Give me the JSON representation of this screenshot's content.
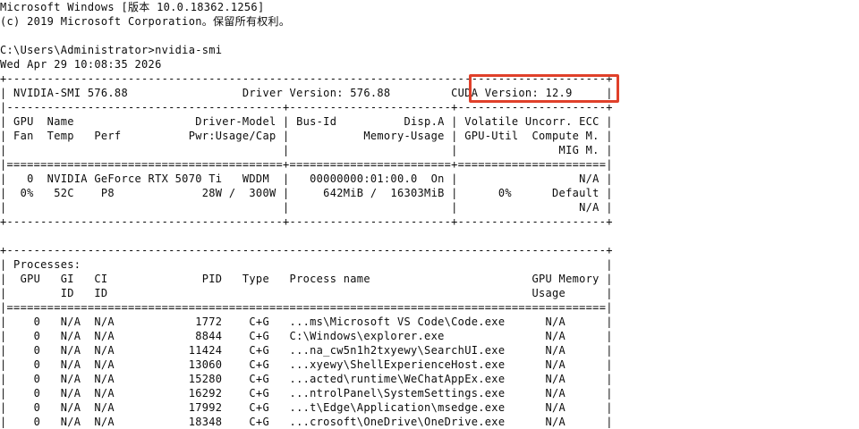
{
  "window": {
    "header_line_1": "Microsoft Windows [版本 10.0.18362.1256]",
    "header_line_2": "(c) 2019 Microsoft Corporation。保留所有权利。",
    "prompt_command": "C:\\Users\\Administrator>nvidia-smi",
    "timestamp": "Wed Apr 29 10:08:35 2026"
  },
  "smi": {
    "border_top": "+-----------------------------------------------------------------------------------------+",
    "summary_row": "| NVIDIA-SMI 576.88                 Driver Version: 576.88         CUDA Version: 12.9     |",
    "summary_sep": "|-----------------------------------------+------------------------+----------------------+",
    "header_row_1": "| GPU  Name                  Driver-Model | Bus-Id          Disp.A | Volatile Uncorr. ECC |",
    "header_row_2": "| Fan  Temp   Perf          Pwr:Usage/Cap |           Memory-Usage | GPU-Util  Compute M. |",
    "header_row_3": "|                                         |                        |               MIG M. |",
    "header_sep": "|=========================================+========================+======================|",
    "gpu_row_1": "|   0  NVIDIA GeForce RTX 5070 Ti   WDDM  |   00000000:01:00.0  On |                  N/A |",
    "gpu_row_2": "|  0%   52C    P8             28W /  300W |     642MiB /  16303MiB |      0%      Default |",
    "gpu_row_3": "|                                         |                        |                  N/A |",
    "border_bottom": "+-----------------------------------------+------------------------+----------------------+"
  },
  "highlight": {
    "color": "#e0402a",
    "target": "CUDA Version: 12.9"
  },
  "processes": {
    "border_top": "+-----------------------------------------------------------------------------------------+",
    "title_row": "| Processes:                                                                              |",
    "header_row_1": "|  GPU   GI   CI              PID   Type   Process name                        GPU Memory |",
    "header_row_2": "|        ID   ID                                                               Usage      |",
    "header_sep": "|=========================================================================================|",
    "rows": [
      "|    0   N/A  N/A            1772    C+G   ...ms\\Microsoft VS Code\\Code.exe      N/A      |",
      "|    0   N/A  N/A            8844    C+G   C:\\Windows\\explorer.exe               N/A      |",
      "|    0   N/A  N/A           11424    C+G   ...na_cw5n1h2txyewy\\SearchUI.exe      N/A      |",
      "|    0   N/A  N/A           13060    C+G   ...xyewy\\ShellExperienceHost.exe      N/A      |",
      "|    0   N/A  N/A           15280    C+G   ...acted\\runtime\\WeChatAppEx.exe      N/A      |",
      "|    0   N/A  N/A           16292    C+G   ...ntrolPanel\\SystemSettings.exe      N/A      |",
      "|    0   N/A  N/A           17992    C+G   ...t\\Edge\\Application\\msedge.exe      N/A      |",
      "|    0   N/A  N/A           18348    C+G   ...crosoft\\OneDrive\\OneDrive.exe      N/A      |"
    ]
  }
}
